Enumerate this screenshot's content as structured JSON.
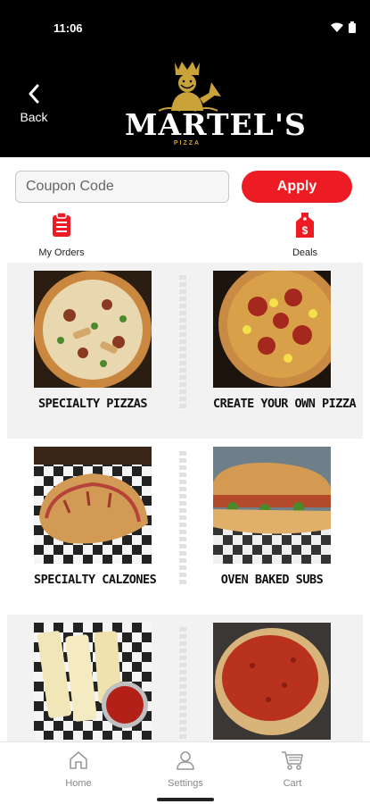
{
  "status": {
    "time": "11:06"
  },
  "header": {
    "back_label": "Back",
    "logo_title": "MARTEL'S",
    "logo_subtitle": "PIZZA"
  },
  "coupon": {
    "placeholder": "Coupon Code",
    "apply_label": "Apply"
  },
  "quick_links": [
    {
      "label": "My Orders",
      "icon": "clipboard-list-icon"
    },
    {
      "label": "Deals",
      "icon": "price-tag-dollar-icon"
    }
  ],
  "menu": [
    {
      "title": "SPECIALTY PIZZAS",
      "image": "specialty-pizza-image"
    },
    {
      "title": "CREATE YOUR OWN PIZZA",
      "image": "pepperoni-pizza-image"
    },
    {
      "title": "SPECIALTY CALZONES",
      "image": "calzone-image"
    },
    {
      "title": "OVEN BAKED SUBS",
      "image": "sub-sandwich-image"
    },
    {
      "title": "",
      "image": "breadsticks-image"
    },
    {
      "title": "",
      "image": "sauce-pizza-image"
    }
  ],
  "tabs": [
    {
      "label": "Home",
      "icon": "home-icon"
    },
    {
      "label": "Settings",
      "icon": "person-icon"
    },
    {
      "label": "Cart",
      "icon": "cart-icon"
    }
  ],
  "colors": {
    "accent": "#ed1c24",
    "header_bg": "#000000",
    "logo_gold": "#c9a23a"
  }
}
